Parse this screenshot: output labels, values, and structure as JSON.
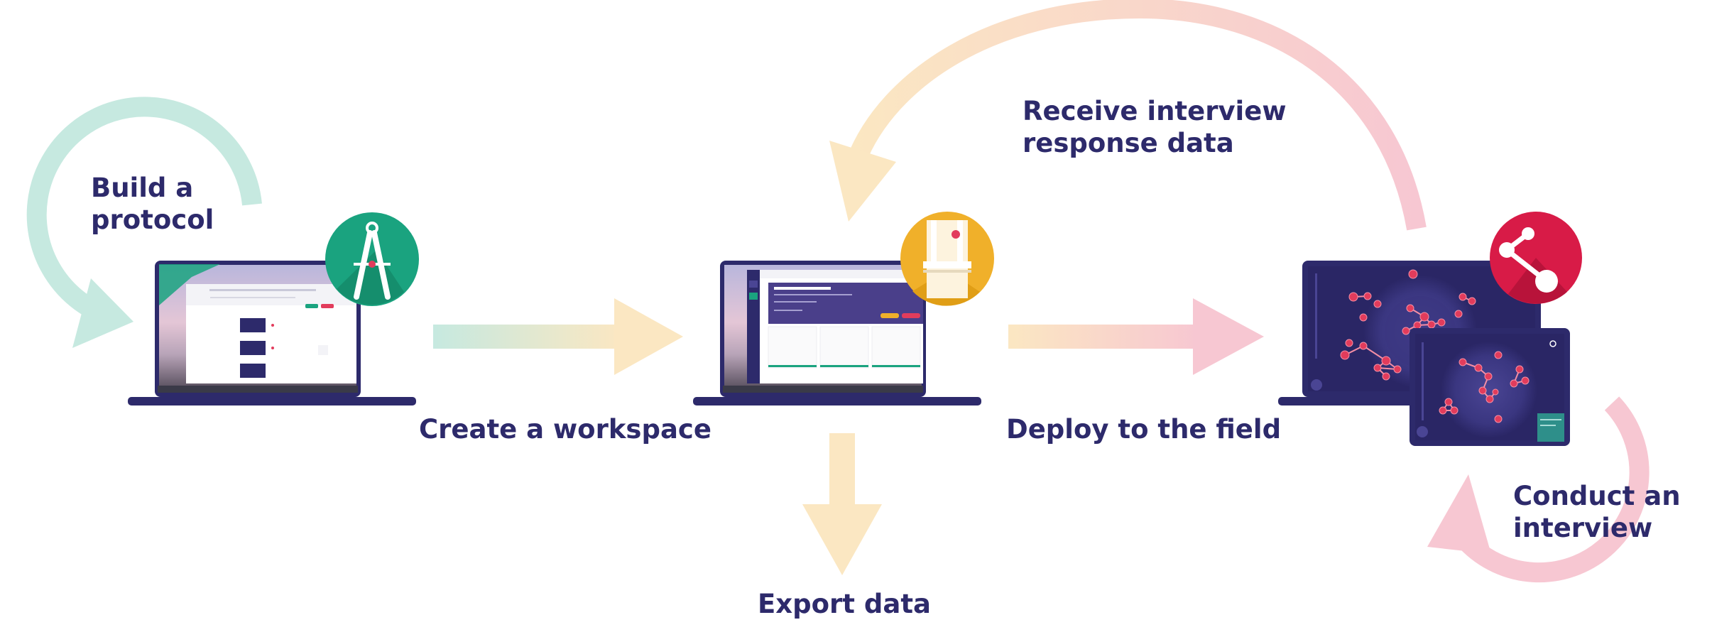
{
  "steps": {
    "build": {
      "line1": "Build a",
      "line2": "protocol"
    },
    "create": {
      "label": "Create a workspace"
    },
    "deploy": {
      "label": "Deploy to the field"
    },
    "export": {
      "label": "Export data"
    },
    "receive": {
      "line1": "Receive interview",
      "line2": "response data"
    },
    "conduct": {
      "line1": "Conduct an",
      "line2": "interview"
    }
  },
  "badges": {
    "architect": {
      "icon": "compass-icon",
      "color": "#1aa37f"
    },
    "server": {
      "icon": "server-icon",
      "color": "#f0b02a"
    },
    "interviewer": {
      "icon": "share-network-icon",
      "color": "#d81b47"
    }
  },
  "colors": {
    "label_text": "#2d2a6b",
    "teal_arrow": "#c6e9e0",
    "yellow_arrow": "#fbe7c2",
    "pink_arrow": "#f7c7d2",
    "device_frame": "#2d2a6b",
    "interviewer_screen": "#2a2665",
    "node_red": "#e23c5c"
  }
}
